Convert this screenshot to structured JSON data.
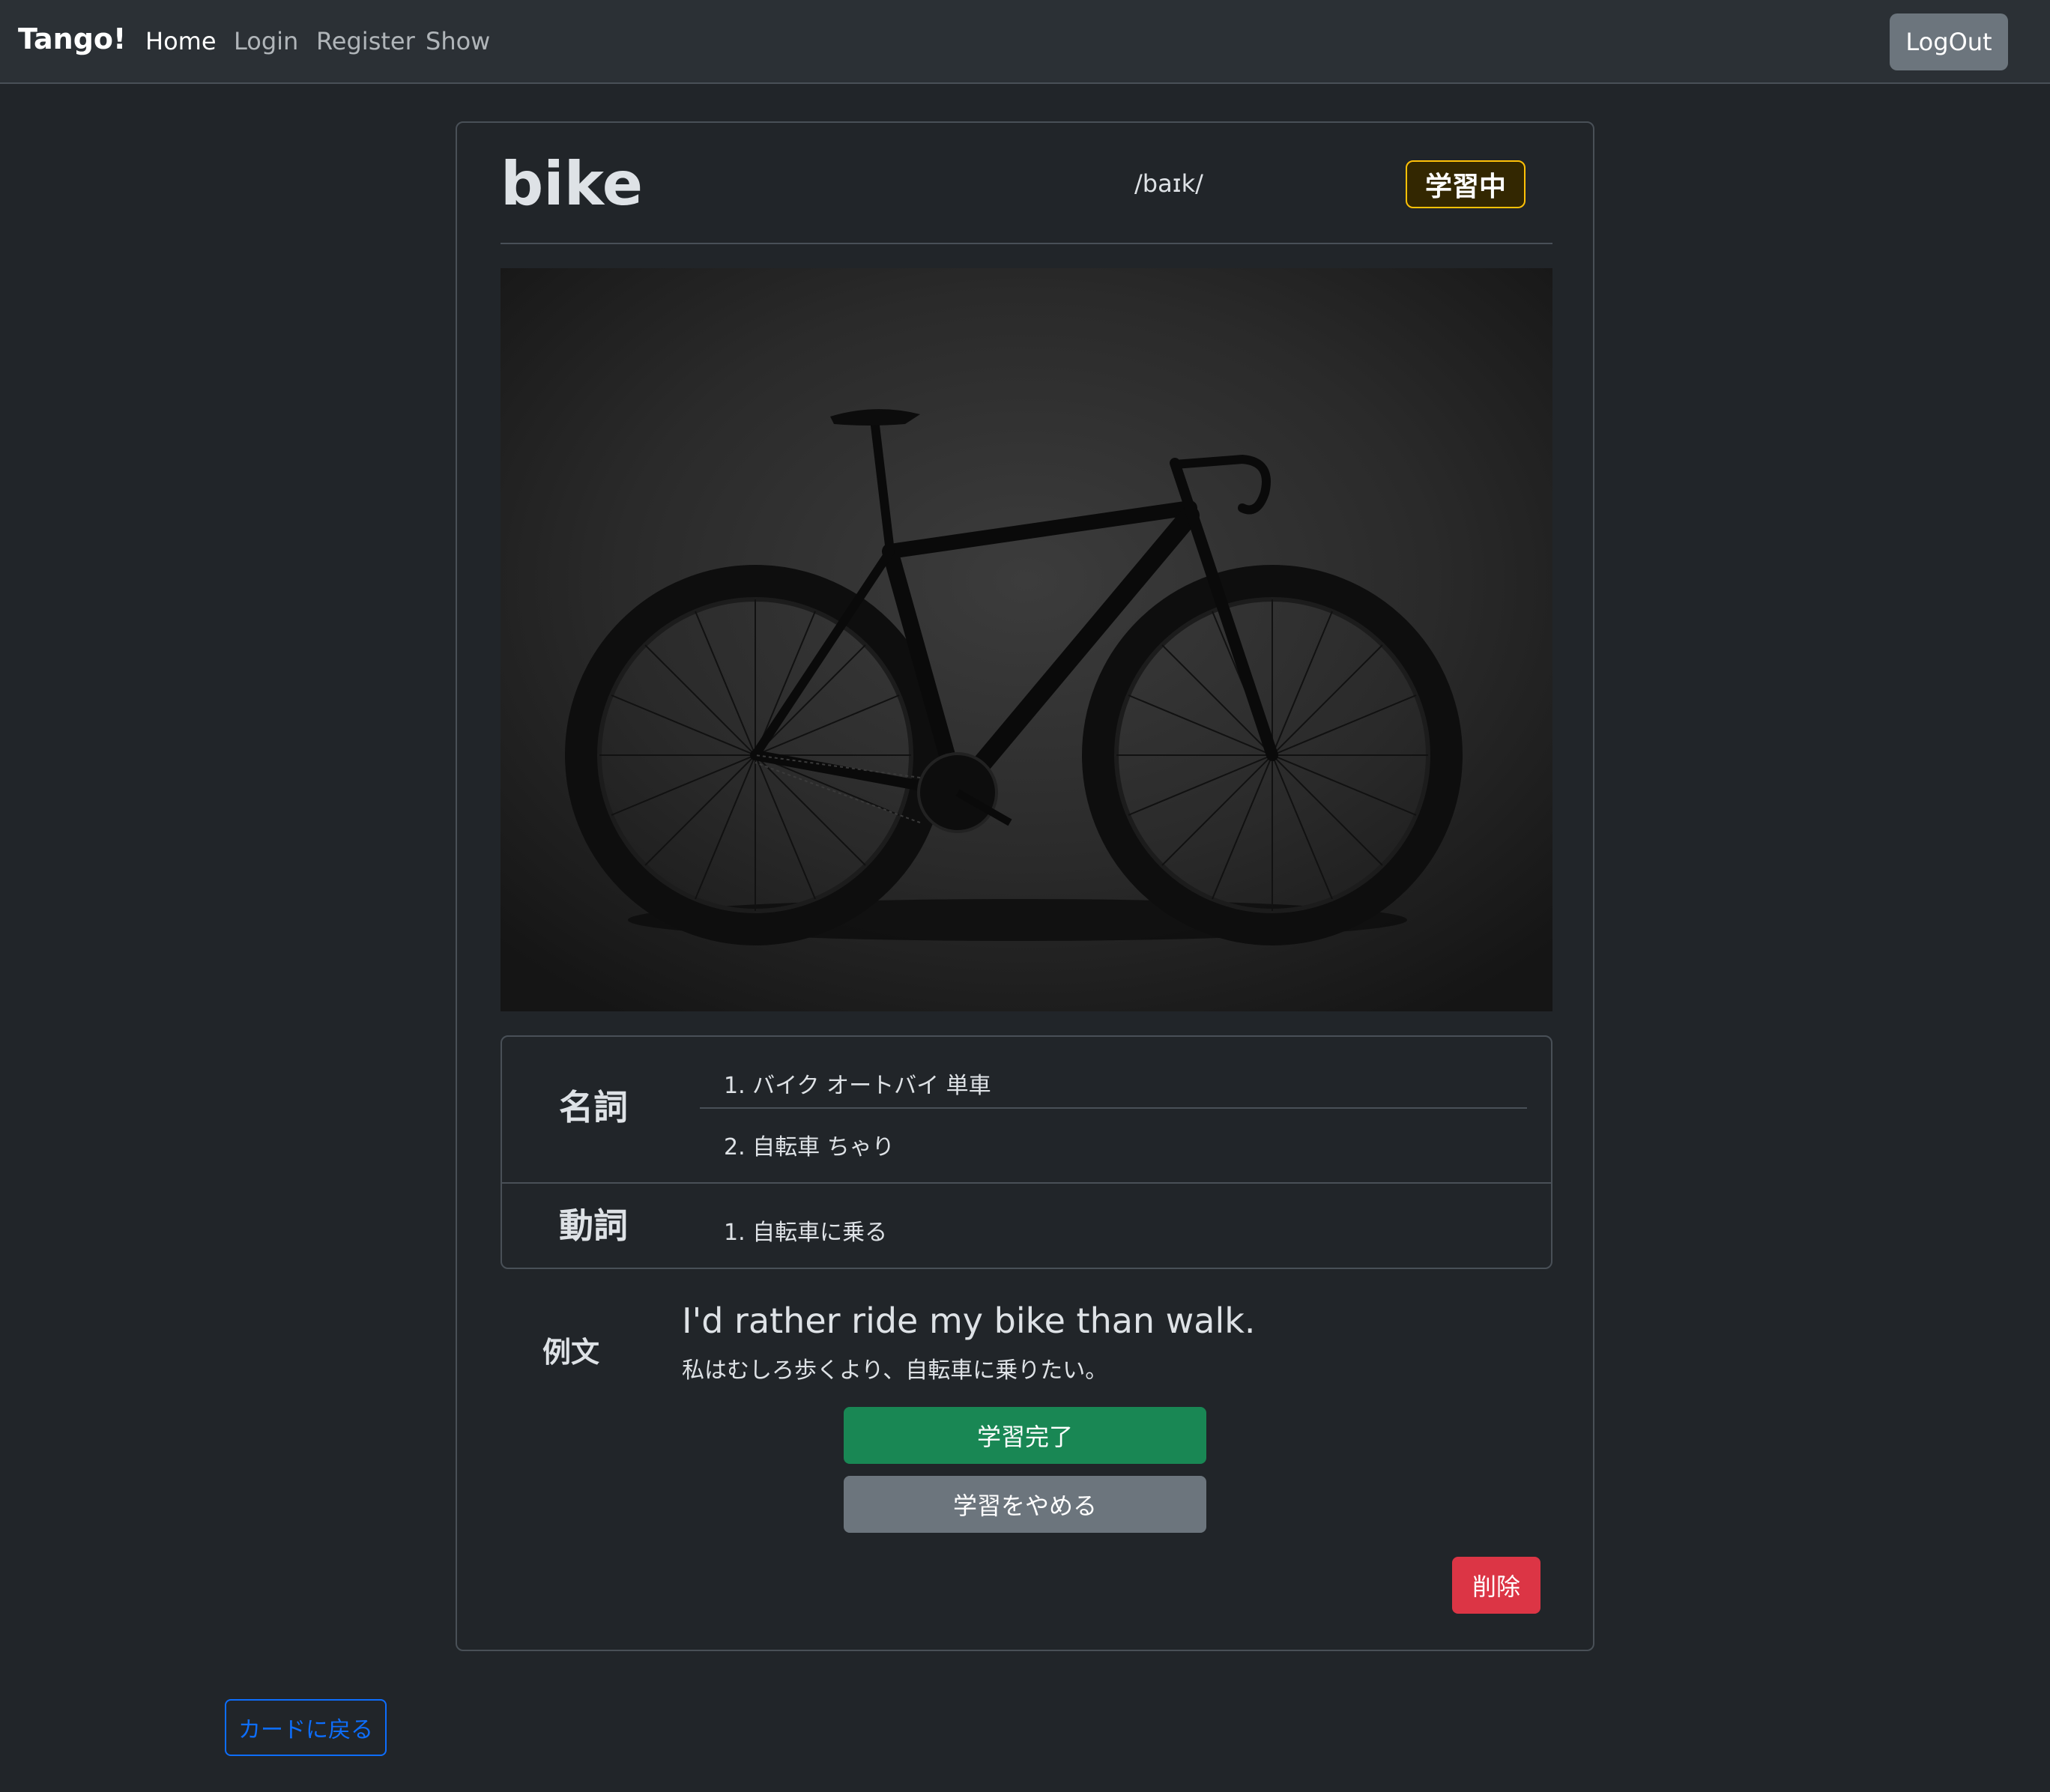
{
  "navbar": {
    "brand": "Tango!",
    "links": [
      "Home",
      "Login",
      "Register",
      "Show"
    ],
    "logout_label": "LogOut"
  },
  "card": {
    "word": "bike",
    "pronunciation": "/baɪk/",
    "status": "学習中",
    "image_icon": "bicycle-photo",
    "definitions": [
      {
        "pos": "名詞",
        "meanings": [
          "1. バイク オートバイ 単車",
          "2. 自転車 ちゃり"
        ]
      },
      {
        "pos": "動詞",
        "meanings": [
          "1. 自転車に乗る"
        ]
      }
    ],
    "example_label": "例文",
    "example_en": "I'd rather ride my bike than walk.",
    "example_ja": "私はむしろ歩くより、自転車に乗りたい。",
    "complete_label": "学習完了",
    "stop_label": "学習をやめる",
    "delete_label": "削除"
  },
  "back_label": "カードに戻る",
  "colors": {
    "background": "#212529",
    "navbar": "#2b3035",
    "success": "#198754",
    "secondary": "#6c757d",
    "danger": "#dc3545",
    "primary": "#0d6efd",
    "warning": "#ffc107"
  }
}
